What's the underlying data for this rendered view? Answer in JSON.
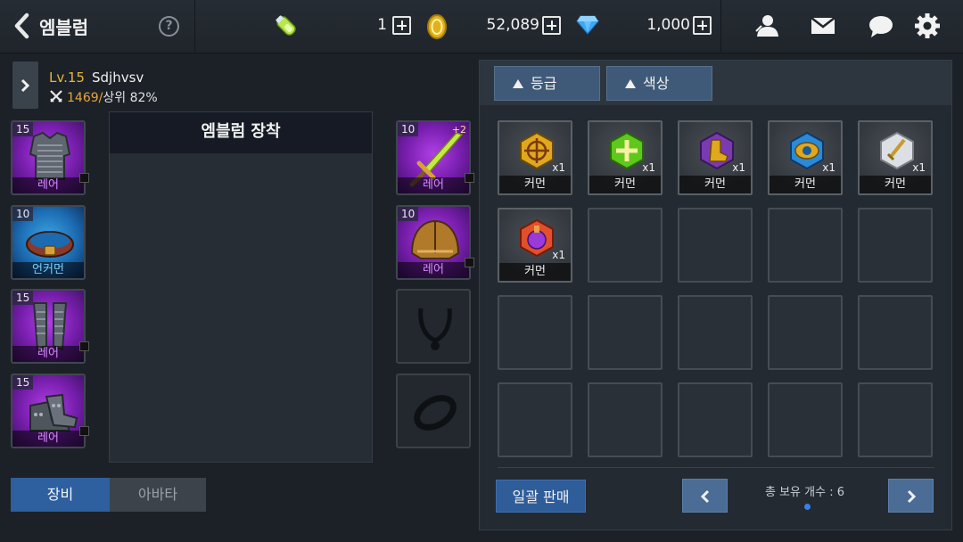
{
  "header": {
    "title": "엠블럼",
    "help": "?",
    "stamina": "1",
    "gold": "52,089",
    "gems": "1,000"
  },
  "character": {
    "level": "Lv.15",
    "name": "Sdjhvsv",
    "power": "1469",
    "separator": "/",
    "rank": "상위 82%"
  },
  "equipment": {
    "left_slots": [
      {
        "level": "15",
        "grade": "레어",
        "item": "chest-armor"
      },
      {
        "level": "10",
        "grade": "언커먼",
        "item": "belt"
      },
      {
        "level": "15",
        "grade": "레어",
        "item": "leg-armor"
      },
      {
        "level": "15",
        "grade": "레어",
        "item": "boots"
      }
    ],
    "right_slots": [
      {
        "level": "10",
        "grade": "레어",
        "enhance": "+2",
        "item": "sword"
      },
      {
        "level": "10",
        "grade": "레어",
        "item": "helmet"
      },
      {
        "item": "necklace-empty"
      },
      {
        "item": "ring-empty"
      }
    ]
  },
  "emblem_panel": {
    "title": "엠블럼 장착"
  },
  "tabs": {
    "equip": "장비",
    "avatar": "아바타"
  },
  "inventory": {
    "sort_buttons": [
      "등급",
      "색상"
    ],
    "items": [
      {
        "grade": "커먼",
        "count": "x1",
        "icon": "gold-crosshair-emblem-icon"
      },
      {
        "grade": "커먼",
        "count": "x1",
        "icon": "green-cross-emblem-icon"
      },
      {
        "grade": "커먼",
        "count": "x1",
        "icon": "purple-boot-emblem-icon"
      },
      {
        "grade": "커먼",
        "count": "x1",
        "icon": "blue-eye-emblem-icon"
      },
      {
        "grade": "커먼",
        "count": "x1",
        "icon": "white-sword-emblem-icon"
      },
      {
        "grade": "커먼",
        "count": "x1",
        "icon": "red-potion-emblem-icon"
      }
    ],
    "bulk_sell": "일괄 판매",
    "total_label": "총 보유 개수 : 6"
  },
  "colors": {
    "rare": "#9b30d9",
    "uncommon": "#2a8ad8",
    "accent_blue": "#2f5d9a",
    "gold_text": "#e8b43a"
  }
}
